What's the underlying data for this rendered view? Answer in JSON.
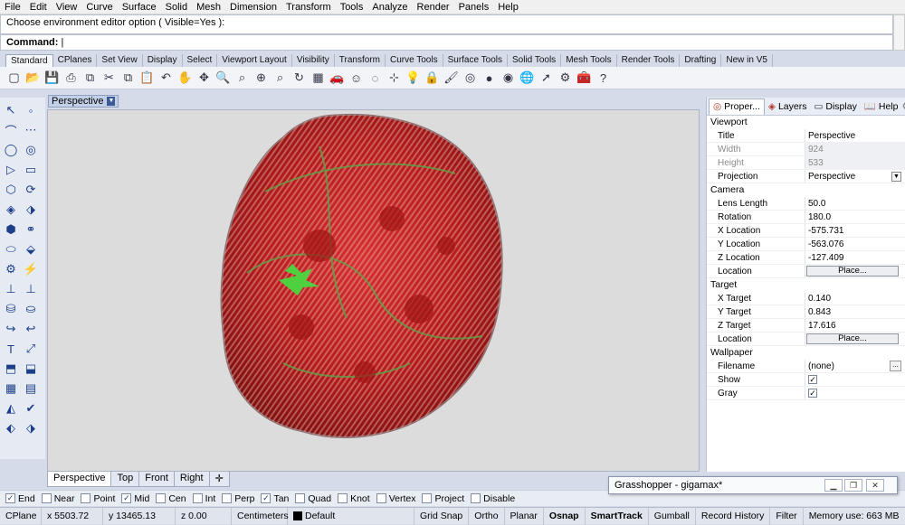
{
  "menu": [
    "File",
    "Edit",
    "View",
    "Curve",
    "Surface",
    "Solid",
    "Mesh",
    "Dimension",
    "Transform",
    "Tools",
    "Analyze",
    "Render",
    "Panels",
    "Help"
  ],
  "command": {
    "history": "Choose environment editor option ( Visible=Yes ):",
    "prompt": "Command:"
  },
  "toolbar_tabs": [
    "Standard",
    "CPlanes",
    "Set View",
    "Display",
    "Select",
    "Viewport Layout",
    "Visibility",
    "Transform",
    "Curve Tools",
    "Surface Tools",
    "Solid Tools",
    "Mesh Tools",
    "Render Tools",
    "Drafting",
    "New in V5"
  ],
  "toolbar_icons": [
    "new-file-icon",
    "open-folder-icon",
    "save-icon",
    "print-icon",
    "import-icon",
    "cut-icon",
    "copy-icon",
    "paste-icon",
    "undo-icon",
    "pan-hand-icon",
    "move-icon",
    "zoom-icon",
    "zoom-window-icon",
    "zoom-extents-icon",
    "zoom-selected-icon",
    "rotate-view-icon",
    "viewport-layout-icon",
    "car-icon",
    "smiley-icon",
    "lasso-icon",
    "snap-icon",
    "light-bulb-icon",
    "lock-icon",
    "paint-icon",
    "color-wheel-icon",
    "sphere-render-icon",
    "chrome-sphere-icon",
    "globe-icon",
    "pointer-edit-icon",
    "settings-gear-icon",
    "toolbox-icon",
    "help-icon"
  ],
  "viewport": {
    "title": "Perspective",
    "tabs": [
      "Perspective",
      "Top",
      "Front",
      "Right"
    ]
  },
  "panel": {
    "tabs": [
      "Proper...",
      "Layers",
      "Display",
      "Help"
    ],
    "sections": [
      {
        "name": "Viewport",
        "rows": [
          {
            "k": "Title",
            "v": "Perspective"
          },
          {
            "k": "Width",
            "v": "924",
            "dis": true
          },
          {
            "k": "Height",
            "v": "533",
            "dis": true
          },
          {
            "k": "Projection",
            "v": "Perspective",
            "dd": true
          }
        ]
      },
      {
        "name": "Camera",
        "rows": [
          {
            "k": "Lens Length",
            "v": "50.0"
          },
          {
            "k": "Rotation",
            "v": "180.0"
          },
          {
            "k": "X Location",
            "v": "-575.731"
          },
          {
            "k": "Y Location",
            "v": "-563.076"
          },
          {
            "k": "Z Location",
            "v": "-127.409"
          },
          {
            "k": "Location",
            "btn": "Place..."
          }
        ]
      },
      {
        "name": "Target",
        "rows": [
          {
            "k": "X Target",
            "v": "0.140"
          },
          {
            "k": "Y Target",
            "v": "0.843"
          },
          {
            "k": "Z Target",
            "v": "17.616"
          },
          {
            "k": "Location",
            "btn": "Place..."
          }
        ]
      },
      {
        "name": "Wallpaper",
        "rows": [
          {
            "k": "Filename",
            "v": "(none)",
            "dots": "..."
          },
          {
            "k": "Show",
            "chk": true
          },
          {
            "k": "Gray",
            "chk": true
          }
        ]
      }
    ]
  },
  "osnap": [
    {
      "l": "End",
      "c": true
    },
    {
      "l": "Near",
      "c": false
    },
    {
      "l": "Point",
      "c": false
    },
    {
      "l": "Mid",
      "c": true
    },
    {
      "l": "Cen",
      "c": false
    },
    {
      "l": "Int",
      "c": false
    },
    {
      "l": "Perp",
      "c": false
    },
    {
      "l": "Tan",
      "c": true
    },
    {
      "l": "Quad",
      "c": false
    },
    {
      "l": "Knot",
      "c": false
    },
    {
      "l": "Vertex",
      "c": false
    },
    {
      "l": "Project",
      "c": false
    },
    {
      "l": "Disable",
      "c": false
    }
  ],
  "status": {
    "cplane": "CPlane",
    "x": "x 5503.72",
    "y": "y 13465.13",
    "z": "z 0.00",
    "units": "Centimeters",
    "layer": "Default",
    "toggles": [
      "Grid Snap",
      "Ortho",
      "Planar",
      "Osnap",
      "SmartTrack",
      "Gumball",
      "Record History",
      "Filter"
    ],
    "bold": [
      "Osnap",
      "SmartTrack"
    ],
    "memory": "Memory use: 663 MB"
  },
  "grasshopper": {
    "title": "Grasshopper - gigamax*"
  },
  "colors": {
    "object_red": "#c02020",
    "object_green": "#4fbf3a",
    "viewport_bg": "#dcdcdc"
  }
}
